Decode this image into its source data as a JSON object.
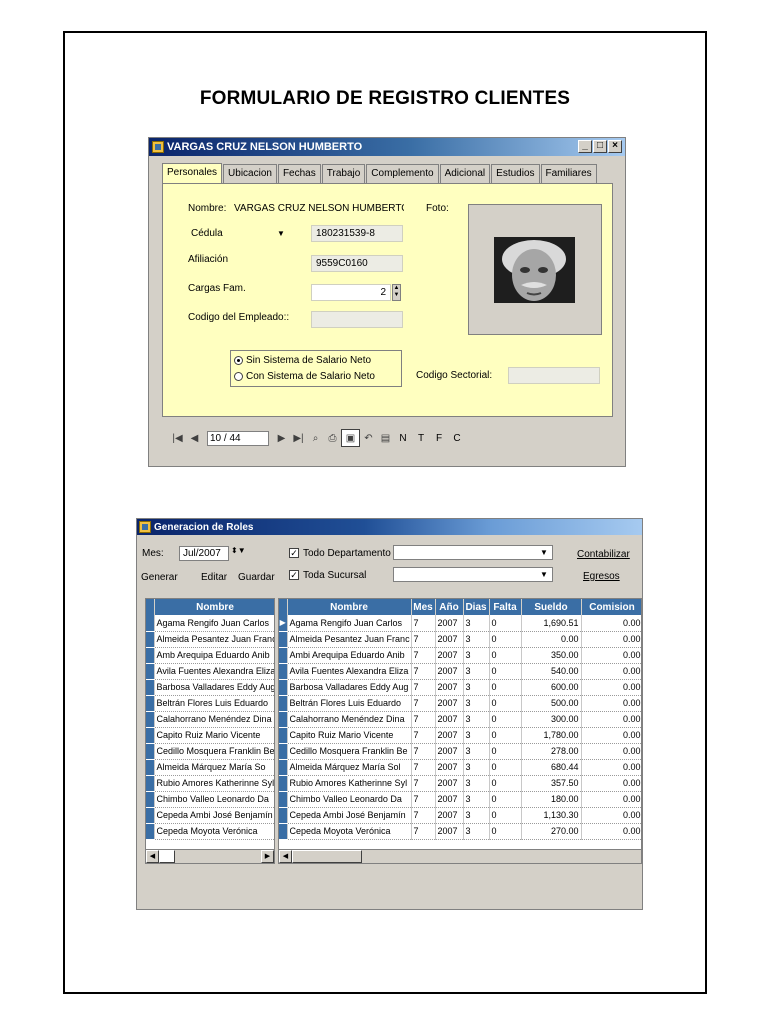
{
  "document": {
    "title": "FORMULARIO DE REGISTRO CLIENTES"
  },
  "client_window": {
    "title": "VARGAS CRUZ NELSON HUMBERTO",
    "tabs": [
      "Personales",
      "Ubicacion",
      "Fechas",
      "Trabajo",
      "Complemento",
      "Adicional",
      "Estudios",
      "Familiares"
    ],
    "active_tab": "Personales",
    "form": {
      "nombre_label": "Nombre:",
      "nombre_value": "VARGAS CRUZ NELSON HUMBERTO",
      "doc_type_value": "Cédula",
      "doc_number_value": "180231539-8",
      "afiliacion_label": "Afiliación",
      "afiliacion_value": "9559C0160",
      "cargas_label": "Cargas Fam.",
      "cargas_value": "2",
      "codigo_empleado_label": "Codigo del Empleado::",
      "codigo_empleado_value": "",
      "foto_label": "Foto:",
      "radio_sin": "Sin Sistema de Salario Neto",
      "radio_con": "Con Sistema de Salario Neto",
      "codigo_sectorial_label": "Codigo Sectorial:",
      "codigo_sectorial_value": ""
    },
    "navigator": {
      "record": "10 / 44",
      "letters": [
        "N",
        "T",
        "F",
        "C"
      ]
    }
  },
  "roles_window": {
    "title": "Generacion de Roles",
    "mes_label": "Mes:",
    "mes_value": "Jul/2007",
    "buttons": {
      "generar": "Generar",
      "editar": "Editar",
      "guardar": "Guardar",
      "contabilizar": "Contabilizar",
      "egresos": "Egresos"
    },
    "chk_departamento": "Todo Departamento",
    "chk_sucursal": "Toda Sucursal",
    "left_grid": {
      "header": "Nombre",
      "rows": [
        "Agama Rengifo Juan Carlos",
        "Almeida Pesantez Juan Franc",
        "Amb Arequipa Eduardo Anib",
        "Avila Fuentes Alexandra Eliza",
        "Barbosa Valladares Eddy Aug",
        "Beltrán Flores Luis Eduardo",
        "Calahorrano Menéndez Dina",
        "Capito Ruiz Mario Vicente",
        "Cedillo Mosquera Franklin Be",
        "Almeida Márquez María So",
        "Rubio Amores Katherinne Syl",
        "Chimbo Valleo Leonardo Da",
        "Cepeda Ambi José Benjamín",
        "Cepeda Moyota Verónica"
      ]
    },
    "right_grid": {
      "headers": [
        "Nombre",
        "Mes",
        "Año",
        "Dias",
        "Falta",
        "Sueldo",
        "Comision"
      ],
      "rows": [
        [
          "Agama Rengifo Juan Carlos",
          "7",
          "2007",
          "3",
          "0",
          "1,690.51",
          "0.00"
        ],
        [
          "Almeida Pesantez Juan Franc",
          "7",
          "2007",
          "3",
          "0",
          "0.00",
          "0.00"
        ],
        [
          "Ambi Arequipa Eduardo Anib",
          "7",
          "2007",
          "3",
          "0",
          "350.00",
          "0.00"
        ],
        [
          "Avila Fuentes Alexandra Eliza",
          "7",
          "2007",
          "3",
          "0",
          "540.00",
          "0.00"
        ],
        [
          "Barbosa Valladares Eddy Aug",
          "7",
          "2007",
          "3",
          "0",
          "600.00",
          "0.00"
        ],
        [
          "Beltrán Flores Luis Eduardo",
          "7",
          "2007",
          "3",
          "0",
          "500.00",
          "0.00"
        ],
        [
          "Calahorrano Menéndez Dina",
          "7",
          "2007",
          "3",
          "0",
          "300.00",
          "0.00"
        ],
        [
          "Capito Ruiz Mario Vicente",
          "7",
          "2007",
          "3",
          "0",
          "1,780.00",
          "0.00"
        ],
        [
          "Cedillo Mosquera Franklin Be",
          "7",
          "2007",
          "3",
          "0",
          "278.00",
          "0.00"
        ],
        [
          "Almeida Márquez María Sol",
          "7",
          "2007",
          "3",
          "0",
          "680.44",
          "0.00"
        ],
        [
          "Rubio Amores Katherinne Syl",
          "7",
          "2007",
          "3",
          "0",
          "357.50",
          "0.00"
        ],
        [
          "Chimbo Valleo Leonardo Da",
          "7",
          "2007",
          "3",
          "0",
          "180.00",
          "0.00"
        ],
        [
          "Cepeda Ambi José Benjamín",
          "7",
          "2007",
          "3",
          "0",
          "1,130.30",
          "0.00"
        ],
        [
          "Cepeda Moyota Verónica",
          "7",
          "2007",
          "3",
          "0",
          "270.00",
          "0.00"
        ]
      ]
    }
  }
}
